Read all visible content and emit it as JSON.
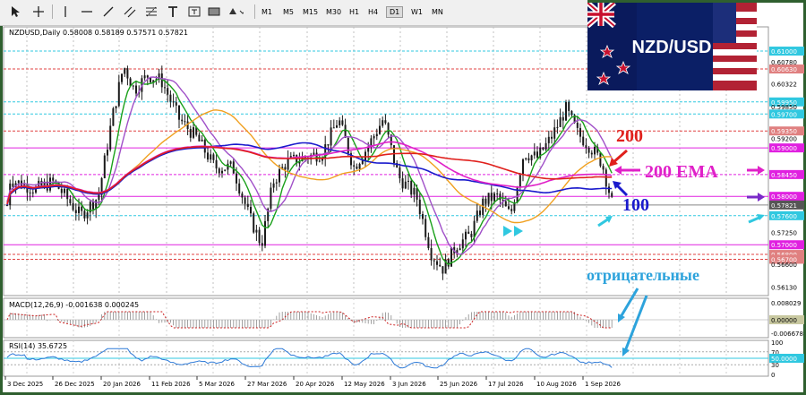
{
  "toolbar": {
    "timeframes": [
      "M1",
      "M5",
      "M15",
      "M30",
      "H1",
      "H4",
      "D1",
      "W1",
      "MN"
    ],
    "active_timeframe": "D1"
  },
  "main": {
    "header": "NZDUSD,Daily  0.58008 0.58189 0.57571 0.57821",
    "price_labels": [
      "0.61000",
      "0.60780",
      "0.60630",
      "0.60322",
      "0.59950",
      "0.59850",
      "0.59700",
      "0.59350",
      "0.59200",
      "0.59000",
      "0.58450",
      "0.58000",
      "0.57821",
      "0.57600",
      "0.57250",
      "0.57000",
      "0.56800",
      "0.56700",
      "0.56600",
      "0.56130"
    ],
    "date_labels": [
      "3 Dec 2025",
      "26 Dec 2025",
      "20 Jan 2026",
      "11 Feb 2026",
      "5 Mar 2026",
      "27 Mar 2026",
      "20 Apr 2026",
      "12 May 2026",
      "3 Jun 2026",
      "25 Jun 2026",
      "17 Jul 2026",
      "10 Aug 2026",
      "1 Sep 2026"
    ]
  },
  "macd": {
    "header": "MACD(12,26,9) -0.001638 0.000245",
    "labels": [
      "0.008029",
      "0.00000",
      "-0.006678"
    ]
  },
  "rsi": {
    "header": "RSI(14) 35.6725",
    "labels": [
      "100",
      "70",
      "50.0000",
      "30",
      "0"
    ]
  },
  "annotations": {
    "ma200": "200",
    "ema200": "200 EMA",
    "ma100": "100",
    "negative": "отрицательные"
  },
  "banner": {
    "pair": "NZD/USD"
  },
  "colors": {
    "ma200": "#e0201c",
    "ema200": "#e020c8",
    "ma100": "#1a1acc",
    "negative": "#2da3dc",
    "price": "#1a1a1a",
    "fast_ma": "#1aa01a",
    "mid_ma": "#a050c8",
    "slow_ma": "#f0a020",
    "lines_magenta": "#e020e0",
    "lines_cyan": "#30c8e0"
  },
  "icons": [
    "cursor-icon",
    "crosshair-icon",
    "vertical-line-icon",
    "horizontal-line-icon",
    "trendline-icon",
    "channel-icon",
    "fibonacci-icon",
    "text-icon",
    "label-icon",
    "rectangle-icon",
    "shapes-icon"
  ]
}
